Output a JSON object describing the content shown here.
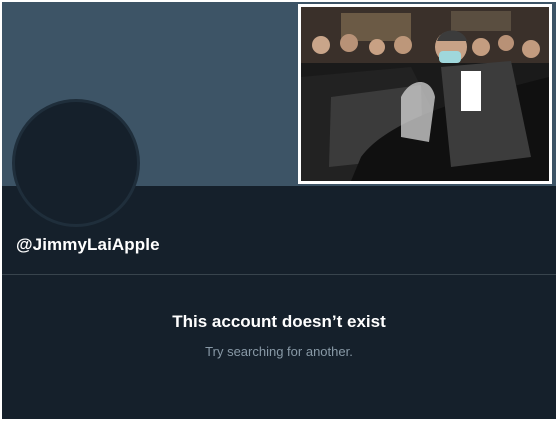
{
  "profile": {
    "handle": "@JimmyLaiApple"
  },
  "empty_state": {
    "title": "This account doesn’t exist",
    "subtitle": "Try searching for another."
  },
  "colors": {
    "background": "#15202b",
    "banner": "#3d5466",
    "primary_text": "#ffffff",
    "secondary_text": "#8899a6"
  }
}
